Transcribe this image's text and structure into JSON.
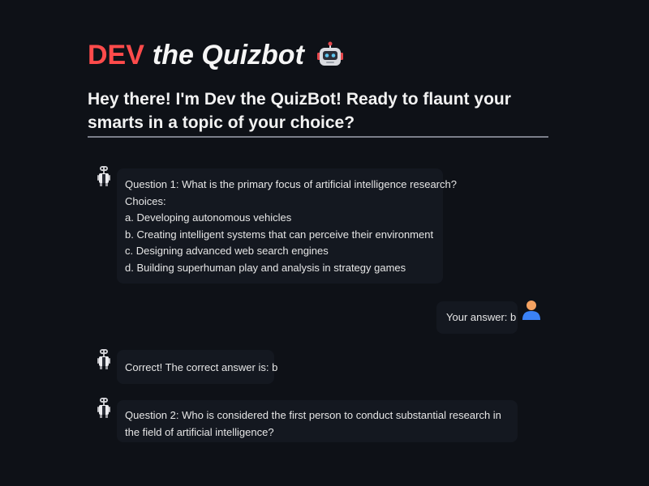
{
  "header": {
    "title_dev": "DEV",
    "title_rest": "the Quizbot",
    "title_icon": "robot-face-icon",
    "subtitle": "Hey there! I'm Dev the QuizBot! Ready to flaunt your smarts in a topic of your choice?"
  },
  "colors": {
    "background": "#0e1117",
    "accent_red": "#ff4b4b",
    "bubble_bg": "#141820",
    "divider": "#7b7f8a",
    "user_avatar_orange": "#f4a261",
    "user_avatar_blue": "#3b82f6"
  },
  "messages": [
    {
      "role": "assistant",
      "avatar": "bot-avatar-icon",
      "lines": [
        "Question 1: What is the primary focus of artificial intelligence research?",
        "Choices:",
        "a. Developing autonomous vehicles",
        "b. Creating intelligent systems that can perceive their environment",
        "c. Designing advanced web search engines",
        "d. Building superhuman play and analysis in strategy games"
      ]
    },
    {
      "role": "user",
      "avatar": "user-avatar-icon",
      "lines": [
        "Your answer: b"
      ]
    },
    {
      "role": "assistant",
      "avatar": "bot-avatar-icon",
      "lines": [
        "Correct! The correct answer is: b"
      ]
    },
    {
      "role": "assistant",
      "avatar": "bot-avatar-icon",
      "lines": [
        "Question 2: Who is considered the first person to conduct substantial research in the field of artificial intelligence?"
      ]
    }
  ]
}
